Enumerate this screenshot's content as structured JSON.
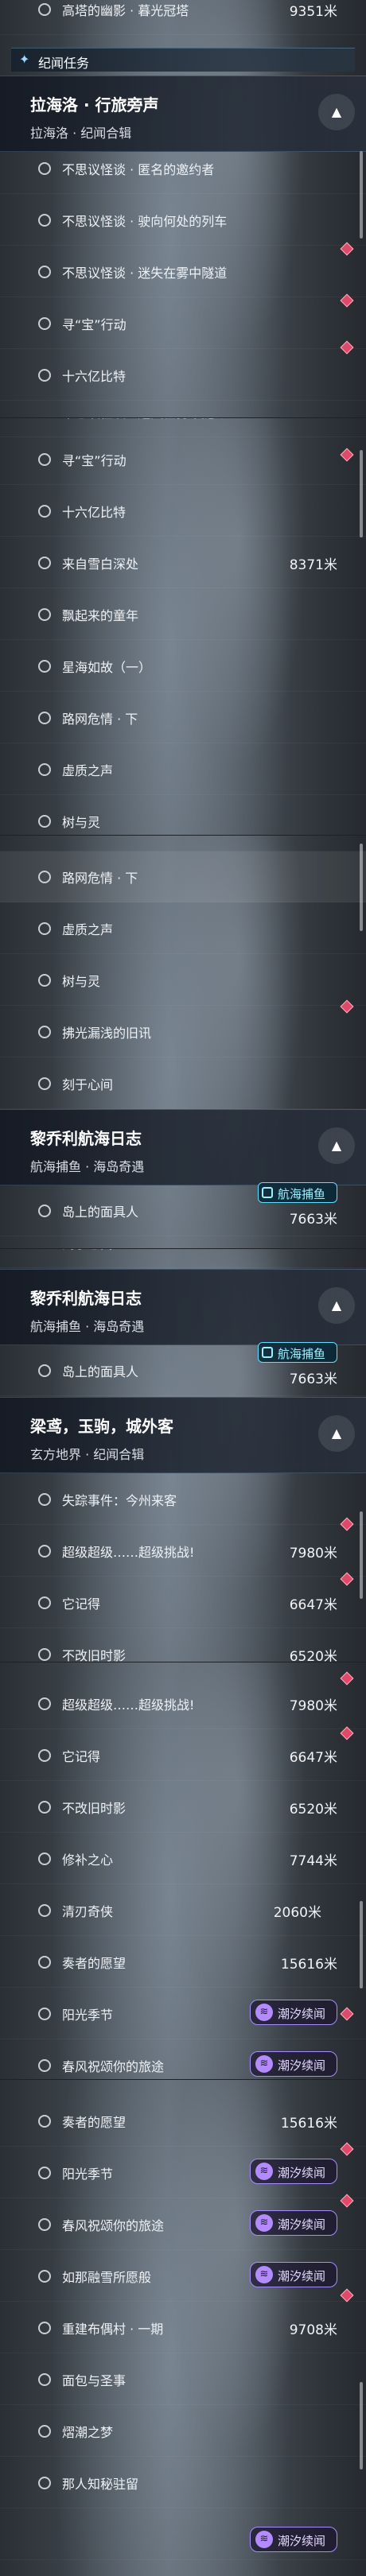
{
  "accent": "#e04a6a",
  "cards": {
    "halo": {
      "label": "潮汐续闻",
      "icon": "wave-icon"
    },
    "fish": {
      "label": "航海捕鱼",
      "icon": "fish-icon"
    }
  },
  "category": {
    "label": "纪闻任务",
    "icon": "sparkle-icon"
  },
  "groups": {
    "lahailuo": {
      "title": "拉海洛 · 行旅旁声",
      "subtitle": "拉海洛 · 纪闻合辑"
    },
    "liqiaoli": {
      "title": "黎乔利航海日志",
      "subtitle": "航海捕鱼 · 海岛奇遇"
    },
    "liangniao": {
      "title": "梁鸢，玉驹，城外客",
      "subtitle": "玄方地界 · 纪闻合辑"
    }
  },
  "quests": {
    "tower": {
      "name": "高塔的幽影 · 暮光冠塔",
      "dist": "9351米"
    },
    "invite": {
      "name": "不思议怪谈 · 匿名的邀约者"
    },
    "train": {
      "name": "不思议怪谈 · 驶向何处的列车"
    },
    "tunnel": {
      "name": "不思议怪谈 · 迷失在雾中隧道"
    },
    "treasure": {
      "name": "寻“宝”行动"
    },
    "sixbillion": {
      "name": "十六亿比特"
    },
    "snowdeep": {
      "name": "来自雪白深处",
      "dist": "8371米"
    },
    "youth": {
      "name": "飘起来的童年"
    },
    "starsea": {
      "name": "星海如故（一）"
    },
    "crisis": {
      "name": "路网危情 · 下"
    },
    "void": {
      "name": "虚质之声"
    },
    "tree": {
      "name": "树与灵"
    },
    "brush": {
      "name": "拂光漏浅的旧讯"
    },
    "heart": {
      "name": "刻于心间"
    },
    "islander": {
      "name": "岛上的面具人",
      "dist": "7663米"
    },
    "missing": {
      "name": "失踪事件：今州来客"
    },
    "super": {
      "name": "超级超级……超级挑战!",
      "dist": "7980米"
    },
    "remember": {
      "name": "它记得",
      "dist": "6647米"
    },
    "noold": {
      "name": "不改旧时影",
      "dist": "6520米"
    },
    "mend": {
      "name": "修补之心",
      "dist": "7744米"
    },
    "hero": {
      "name": "清刃奇侠",
      "dist": "2060米"
    },
    "wish": {
      "name": "奏者的愿望",
      "dist": "15616米"
    },
    "sun": {
      "name": "阳光季节"
    },
    "spring": {
      "name": "春风祝颂你的旅途"
    },
    "dream": {
      "name": "如那融雪所愿般"
    },
    "rebuild": {
      "name": "重建布偶村 · 一期",
      "dist": "9708米"
    },
    "bread": {
      "name": "面包与圣事"
    },
    "summer": {
      "name": "熠潮之梦"
    },
    "frozen": {
      "name": "那人知秘驻留"
    }
  }
}
